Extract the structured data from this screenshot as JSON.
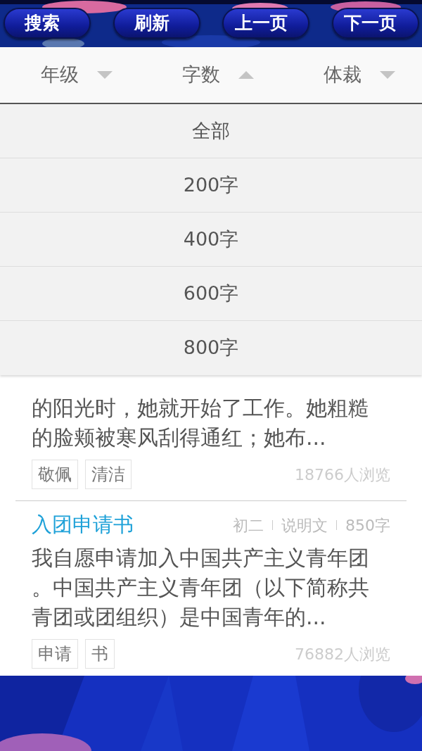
{
  "toolbar": {
    "buttons": [
      "搜索",
      "刷新",
      "上一页",
      "下一页"
    ]
  },
  "filters": [
    {
      "label": "年级",
      "expanded": false
    },
    {
      "label": "字数",
      "expanded": true
    },
    {
      "label": "体裁",
      "expanded": false
    }
  ],
  "dropdown": {
    "options": [
      "全部",
      "200字",
      "400字",
      "600字",
      "800字"
    ]
  },
  "articles": [
    {
      "excerpt": "的阳光时，她就开始了工作。她粗糙的脸颊被寒风刮得通红；她布...",
      "tags": [
        "敬佩",
        "清洁"
      ],
      "views": "18766人浏览"
    },
    {
      "title": "入团申请书",
      "grade": "初二",
      "genre": "说明文",
      "words": "850字",
      "excerpt": "我自愿申请加入中国共产主义青年团。中国共产主义青年团（以下简称共青团或团组织）是中国青年的...",
      "tags": [
        "申请",
        "书"
      ],
      "views": "76882人浏览"
    }
  ]
}
